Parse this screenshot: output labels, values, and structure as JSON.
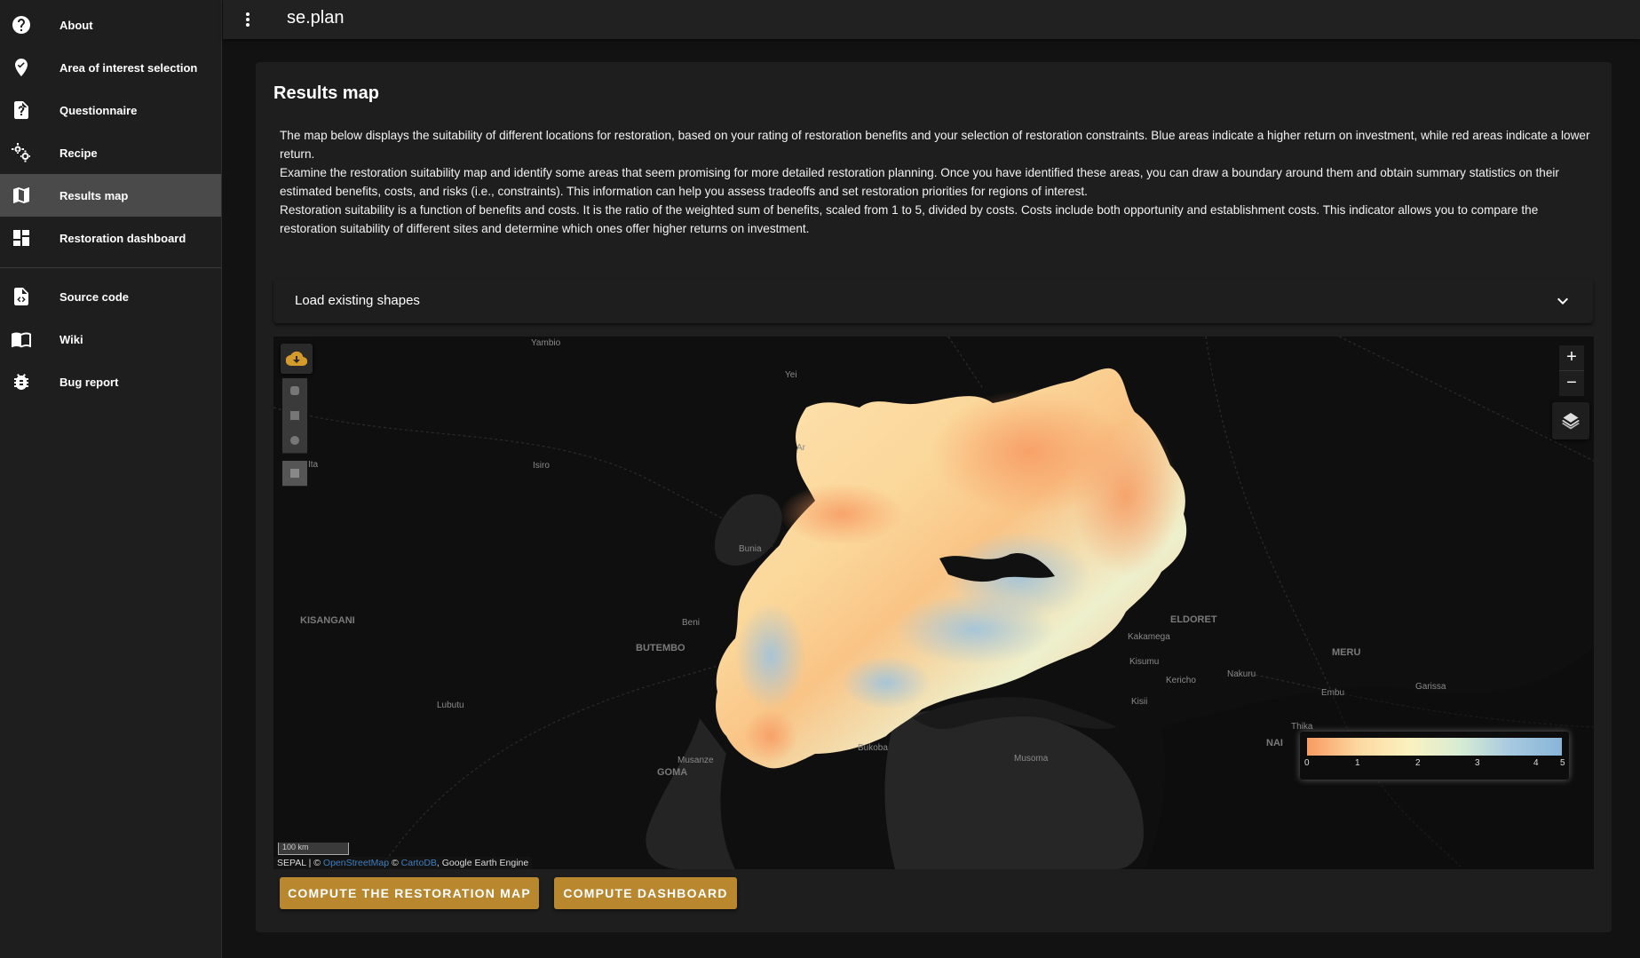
{
  "sidebar": {
    "items": [
      {
        "label": "About",
        "icon": "help-circle-icon"
      },
      {
        "label": "Area of interest selection",
        "icon": "map-marker-check-icon"
      },
      {
        "label": "Questionnaire",
        "icon": "file-question-icon"
      },
      {
        "label": "Recipe",
        "icon": "cogs-icon"
      },
      {
        "label": "Results map",
        "icon": "map-icon",
        "active": true
      },
      {
        "label": "Restoration dashboard",
        "icon": "dashboard-icon"
      }
    ],
    "links": [
      {
        "label": "Source code",
        "icon": "file-code-icon"
      },
      {
        "label": "Wiki",
        "icon": "book-open-icon"
      },
      {
        "label": "Bug report",
        "icon": "bug-icon"
      }
    ]
  },
  "header": {
    "title": "se.plan"
  },
  "main": {
    "title": "Results map",
    "paragraphs": [
      "The map below displays the suitability of different locations for restoration, based on your rating of restoration benefits and your selection of restoration constraints. Blue areas indicate a higher return on investment, while red areas indicate a lower return.",
      "Examine the restoration suitability map and identify some areas that seem promising for more detailed restoration planning. Once you have identified these areas, you can draw a boundary around them and obtain summary statistics on their estimated benefits, costs, and risks (i.e., constraints). This information can help you assess tradeoffs and set restoration priorities for regions of interest.",
      "Restoration suitability is a function of benefits and costs. It is the ratio of the weighted sum of benefits, scaled from 1 to 5, divided by costs. Costs include both opportunity and establishment costs. This indicator allows you to compare the restoration suitability of different sites and determine which ones offer higher returns on investment."
    ],
    "expansion_label": "Load existing shapes"
  },
  "map": {
    "zoom_in": "+",
    "zoom_out": "−",
    "cities": [
      "Yambio",
      "Yei",
      "Isiro",
      "Bunia",
      "KISANGANI",
      "BUTEMBO",
      "Beni",
      "Lubutu",
      "Musanze",
      "GOMA",
      "Bukoba",
      "Musoma",
      "ELDORET",
      "Kakamega",
      "Kisumu",
      "Kericho",
      "Kisii",
      "Nakuru",
      "MERU",
      "Embu",
      "Garissa",
      "Thika",
      "NAI",
      "Ar",
      "Ita"
    ],
    "legend": {
      "ticks": [
        "0",
        "1",
        "2",
        "3",
        "4",
        "5"
      ],
      "colors": [
        "#f89a61",
        "#fcd8a0",
        "#fbf1c0",
        "#d7ecd4",
        "#a6c9e0",
        "#88b5d8"
      ]
    },
    "scale_label": "100 km",
    "attribution": {
      "prefix": "SEPAL | ©",
      "osm": "OpenStreetMap",
      "sep": "©",
      "carto": "CartoDB",
      "suffix": ", Google Earth Engine"
    }
  },
  "buttons": {
    "compute_map": "COMPUTE THE RESTORATION MAP",
    "compute_dashboard": "COMPUTE DASHBOARD"
  },
  "colors": {
    "accent": "#b8872e",
    "sidebar_active": "#4a4a4a"
  }
}
